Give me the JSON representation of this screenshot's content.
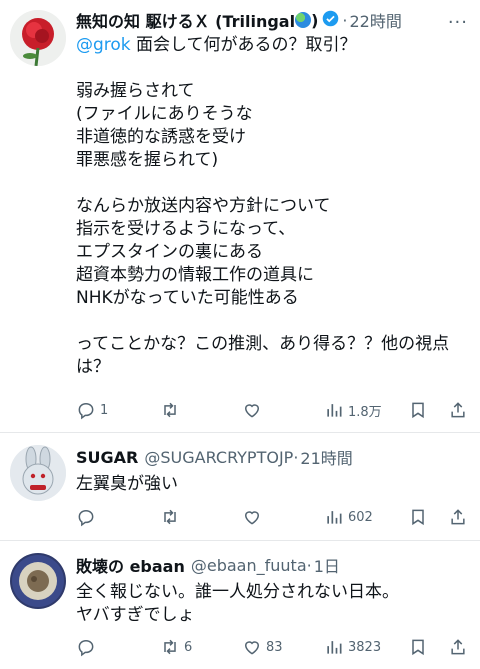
{
  "tweets": [
    {
      "name": "無知の知 駆けるＸ (Trilingal",
      "name_suffix": ")",
      "dot": "·",
      "time": "22時間",
      "more": "···",
      "mention": "@grok",
      "text": " 面会して何があるの？取引？\n\n弱み握らされて\n(ファイルにありそうな\n非道徳的な誘惑を受け\n罪悪感を握られて)\n\nなんらか放送内容や方針について\n指示を受けるようになって、\nエプスタインの裏にある\n超資本勢力の情報工作の道具に\nNHKがなっていた可能性ある\n\nってことかな？この推測、あり得る？？他の視点は？",
      "replies": "1",
      "views": "1.8万",
      "icons": [
        "reply-icon",
        "retweet-icon",
        "like-icon",
        "views-icon",
        "bookmark-icon",
        "share-icon"
      ]
    },
    {
      "name": "SUGAR",
      "handle": "@SUGARCRYPTOJP",
      "dot": "·",
      "time": "21時間",
      "text": "左翼臭が強い",
      "views": "602"
    },
    {
      "name": "敗壊の ebaan",
      "handle": "@ebaan_fuuta",
      "dot": "·",
      "time": "1日",
      "text": "全く報じない。誰一人処分されない日本。\nヤバすぎでしょ",
      "retweets": "6",
      "likes": "83",
      "views": "3823"
    }
  ]
}
